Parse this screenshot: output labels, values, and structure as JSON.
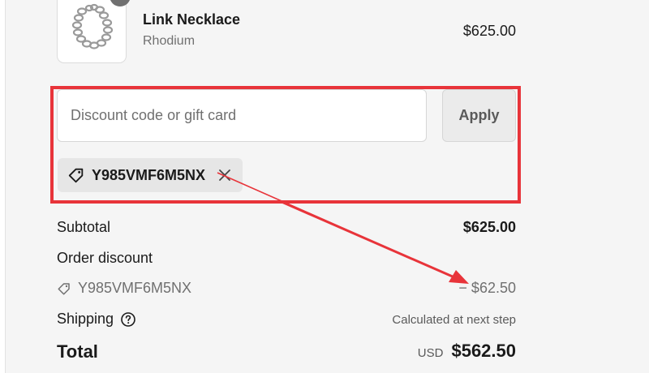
{
  "product": {
    "name": "Link Necklace",
    "variant": "Rhodium",
    "price": "$625.00",
    "image_icon": "necklace-thumbnail"
  },
  "discount": {
    "placeholder": "Discount code or gift card",
    "value": "",
    "apply_label": "Apply",
    "applied_code": "Y985VMF6M5NX"
  },
  "summary": {
    "subtotal_label": "Subtotal",
    "subtotal_value": "$625.00",
    "order_discount_label": "Order discount",
    "discount_code": "Y985VMF6M5NX",
    "discount_amount": "− $62.50",
    "shipping_label": "Shipping",
    "shipping_value": "Calculated at next step",
    "total_label": "Total",
    "currency": "USD",
    "total_value": "$562.50"
  },
  "colors": {
    "annotation": "#e8343a",
    "background": "#f5f5f5",
    "muted_text": "#707070"
  }
}
